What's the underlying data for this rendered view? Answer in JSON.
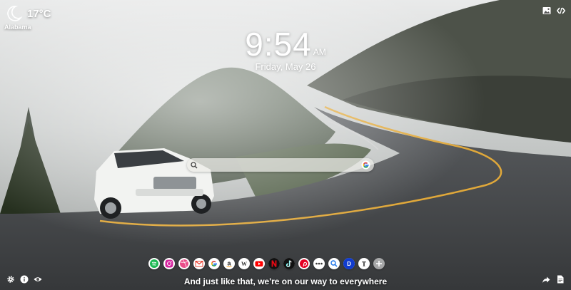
{
  "weather": {
    "temperature": "17°C",
    "location": "Alabama",
    "icon": "moon-icon"
  },
  "clock": {
    "time": "9:54",
    "ampm": "AM",
    "date": "Friday, May 26"
  },
  "top_controls": {
    "icons": [
      "image-icon",
      "code-icon"
    ]
  },
  "search": {
    "value": "",
    "placeholder": "",
    "engine_icon": "google-icon"
  },
  "shortcuts": [
    {
      "name": "spotify",
      "color": "#1DB954"
    },
    {
      "name": "instagram",
      "color": "#E1306C"
    },
    {
      "name": "dribbble",
      "color": "#EA4C89"
    },
    {
      "name": "gmail",
      "color": "#EA4335"
    },
    {
      "name": "google",
      "color": "#4285F4"
    },
    {
      "name": "amazon",
      "color": "#222222"
    },
    {
      "name": "wikipedia",
      "color": "#333333"
    },
    {
      "name": "youtube",
      "color": "#FF0000"
    },
    {
      "name": "netflix",
      "color": "#E50914"
    },
    {
      "name": "tiktok",
      "color": "#111111"
    },
    {
      "name": "pinterest",
      "color": "#E60023"
    },
    {
      "name": "more",
      "color": "#333333"
    },
    {
      "name": "search",
      "color": "#1A73E8"
    },
    {
      "name": "disney",
      "color": "#113CCF"
    },
    {
      "name": "new-york-times",
      "color": "#111111"
    },
    {
      "name": "add",
      "color": "#ffffff"
    }
  ],
  "bottom": {
    "quote": "And just like that, we're on our way to everywhere",
    "left_icons": [
      "settings-icon",
      "info-icon",
      "eye-icon"
    ],
    "right_icons": [
      "share-icon",
      "document-icon"
    ]
  }
}
